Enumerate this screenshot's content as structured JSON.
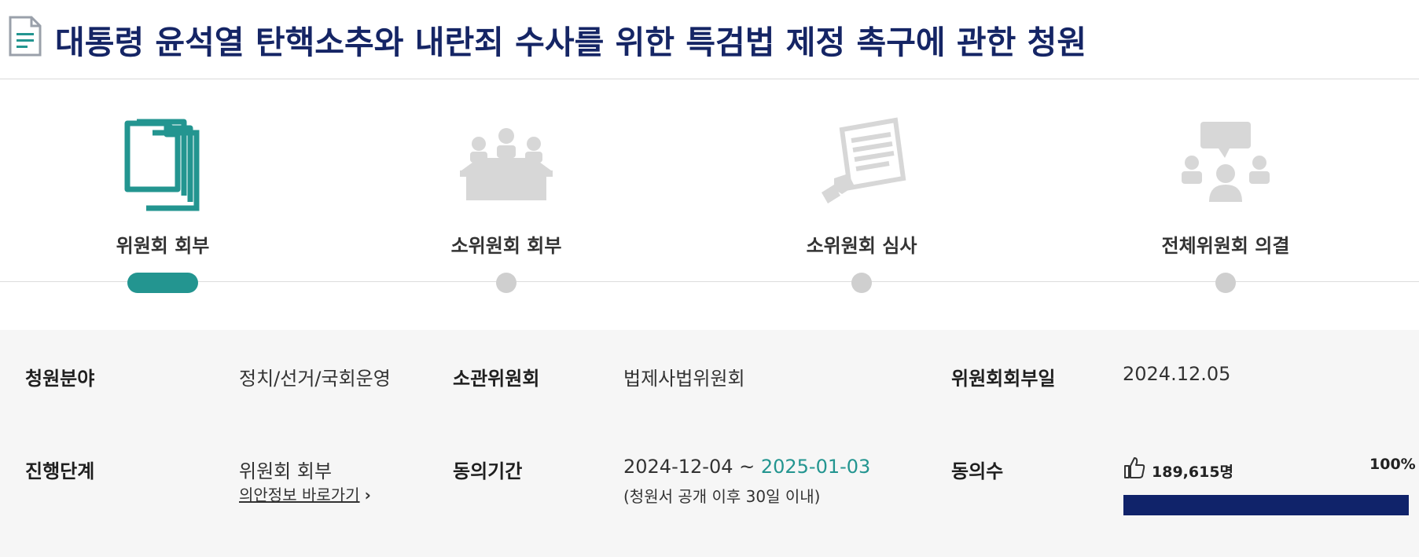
{
  "page": {
    "title": "대통령 윤석열 탄핵소추와 내란죄 수사를 위한 특검법 제정 촉구에 관한 청원"
  },
  "steps": [
    {
      "label": "위원회 회부",
      "icon": "documents-icon",
      "active": true
    },
    {
      "label": "소위원회 회부",
      "icon": "meeting-icon",
      "active": false
    },
    {
      "label": "소위원회 심사",
      "icon": "review-document-icon",
      "active": false
    },
    {
      "label": "전체위원회 의결",
      "icon": "discussion-icon",
      "active": false
    }
  ],
  "info": {
    "field_label": "청원분야",
    "field_value": "정치/선거/국회운영",
    "committee_label": "소관위원회",
    "committee_value": "법제사법위원회",
    "referral_date_label": "위원회회부일",
    "referral_date_value": "2024.12.05",
    "stage_label": "진행단계",
    "stage_value": "위원회 회부",
    "bill_link": "의안정보 바로가기",
    "period_label": "동의기간",
    "period_start": "2024-12-04 ~ ",
    "period_end": "2025-01-03",
    "period_note": "(청원서 공개 이후 30일 이내)",
    "agree_label": "동의수",
    "agree_count": "189,615명",
    "agree_percent": "100%",
    "agree_ratio": 1.0
  },
  "colors": {
    "title": "#152565",
    "accent": "#239590",
    "bar": "#10236a",
    "inactive": "#cfcfcf"
  }
}
